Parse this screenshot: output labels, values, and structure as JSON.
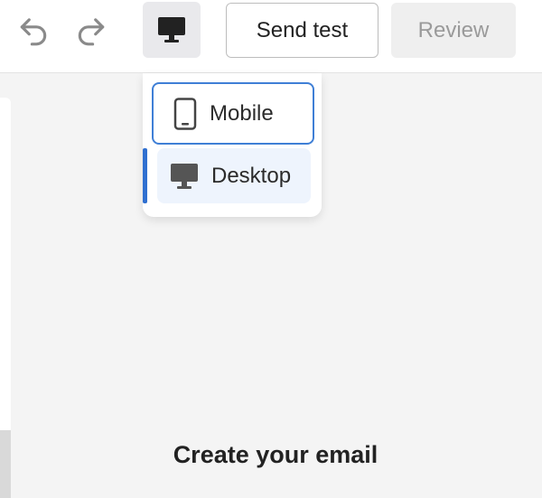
{
  "toolbar": {
    "undo_icon": "undo-icon",
    "redo_icon": "redo-icon",
    "device_icon": "desktop-icon",
    "send_test_label": "Send test",
    "review_label": "Review"
  },
  "device_menu": {
    "items": [
      {
        "label": "Mobile",
        "icon": "mobile-icon",
        "selected": false,
        "focused": true
      },
      {
        "label": "Desktop",
        "icon": "desktop-icon",
        "selected": true,
        "focused": false
      }
    ]
  },
  "canvas": {
    "title": "Create your email"
  },
  "colors": {
    "accent": "#2f6fd0",
    "focus_border": "#3f7fd6",
    "selected_bg": "#eef4fd",
    "icon": "#444444"
  }
}
